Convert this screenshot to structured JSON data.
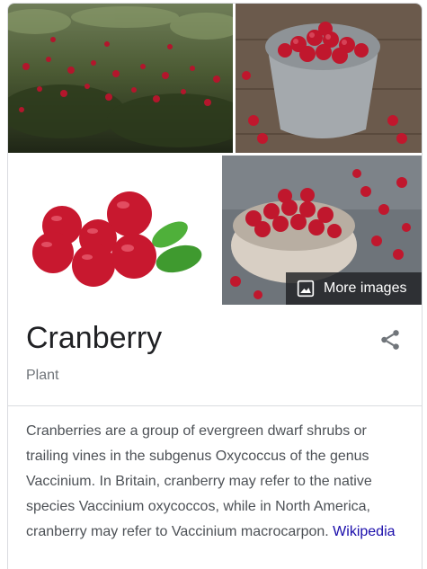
{
  "images": [
    {
      "alt": "cranberry bog shrubs"
    },
    {
      "alt": "cranberries in a metal bucket"
    },
    {
      "alt": "cranberries with leaves"
    },
    {
      "alt": "cranberries in a bowl"
    }
  ],
  "more_images": {
    "label": "More images",
    "icon": "image-icon"
  },
  "entity": {
    "title": "Cranberry",
    "subtitle": "Plant",
    "share_icon": "share-icon"
  },
  "description": {
    "text": "Cranberries are a group of evergreen dwarf shrubs or trailing vines in the subgenus Oxycoccus of the genus Vaccinium. In Britain, cranberry may refer to the native species Vaccinium oxycoccos, while in North America, cranberry may refer to Vaccinium macrocarpon.",
    "source_label": "Wikipedia"
  },
  "colors": {
    "link": "#1a0dab",
    "berry": "#c0172d",
    "leaf": "#3f9a2f"
  }
}
